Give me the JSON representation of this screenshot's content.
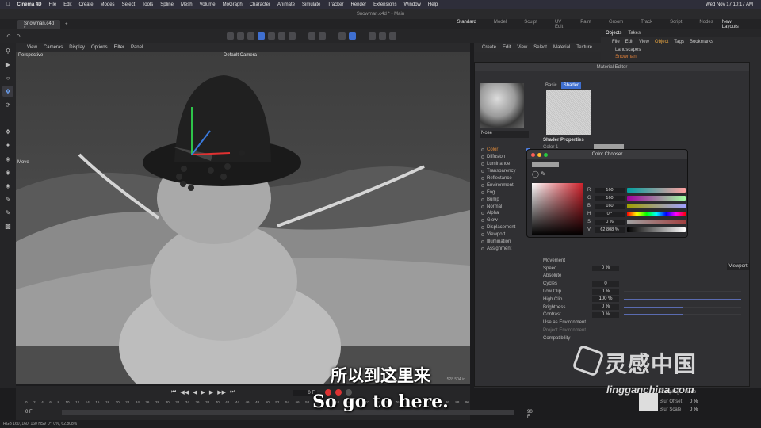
{
  "menubar": {
    "app": "Cinema 4D",
    "items": [
      "File",
      "Edit",
      "Create",
      "Modes",
      "Select",
      "Tools",
      "Spline",
      "Mesh",
      "Volume",
      "MoGraph",
      "Character",
      "Animate",
      "Simulate",
      "Tracker",
      "Render",
      "Extensions",
      "Window",
      "Help"
    ],
    "clock": "Wed Nov 17  10:17 AM"
  },
  "window": {
    "title": "Snowman.c4d * - Main"
  },
  "tabs": {
    "document": "Snowman.c4d *",
    "layouts": [
      "Standard",
      "Model",
      "Sculpt",
      "UV Edit",
      "Paint",
      "Groom",
      "Track",
      "Script",
      "Nodes"
    ],
    "new_layouts": "New Layouts"
  },
  "viewport": {
    "menu": [
      "View",
      "Cameras",
      "Display",
      "Options",
      "Filter",
      "Panel"
    ],
    "label": "Perspective",
    "camera": "Default Camera",
    "tool_hint": "Move",
    "scale": "528.504 in"
  },
  "objects": {
    "tabs": [
      "Objects",
      "Takes"
    ],
    "menu": [
      "File",
      "Edit",
      "View",
      "Object",
      "Tags",
      "Bookmarks"
    ],
    "rows": [
      "Landscapes",
      "Snowman"
    ]
  },
  "material_manager": {
    "menu": [
      "Create",
      "Edit",
      "View",
      "Select",
      "Material",
      "Texture"
    ]
  },
  "material_editor": {
    "title": "Material Editor",
    "name": "Nose",
    "tabs": [
      "Basic",
      "Shader"
    ],
    "shader_heading": "Shader Properties",
    "color_label": "Color 1",
    "channels": [
      {
        "label": "Color",
        "checked": true,
        "active": true
      },
      {
        "label": "Diffusion",
        "checked": false
      },
      {
        "label": "Luminance",
        "checked": false
      },
      {
        "label": "Transparency",
        "checked": false
      },
      {
        "label": "Reflectance",
        "checked": true
      },
      {
        "label": "Environment",
        "checked": false
      },
      {
        "label": "Fog",
        "checked": false
      },
      {
        "label": "Bump",
        "checked": true
      },
      {
        "label": "Normal",
        "checked": false
      },
      {
        "label": "Alpha",
        "checked": false
      },
      {
        "label": "Glow",
        "checked": false
      },
      {
        "label": "Displacement",
        "checked": false
      },
      {
        "label": "Viewport"
      },
      {
        "label": "Illumination"
      },
      {
        "label": "Assignment"
      }
    ],
    "props": [
      {
        "label": "Movement",
        "value": ""
      },
      {
        "label": "Speed",
        "value": "0 %"
      },
      {
        "label": "Absolute",
        "value": ""
      },
      {
        "label": "Cycles",
        "value": "0"
      },
      {
        "label": "Low Clip",
        "value": "0 %",
        "fill": 0.0
      },
      {
        "label": "High Clip",
        "value": "100 %",
        "fill": 1.0
      },
      {
        "label": "Brightness",
        "value": "0 %",
        "fill": 0.5
      },
      {
        "label": "Contrast",
        "value": "0 %",
        "fill": 0.5
      },
      {
        "label": "Use as Environment",
        "value": ""
      },
      {
        "label": "Project Environment",
        "value": "",
        "dim": true
      },
      {
        "label": "Compatibility",
        "value": ""
      }
    ],
    "viewport_btn": "Viewport"
  },
  "color_chooser": {
    "title": "Color Chooser",
    "rows": [
      {
        "label": "R",
        "value": "160"
      },
      {
        "label": "G",
        "value": "160"
      },
      {
        "label": "B",
        "value": "160"
      },
      {
        "label": "H",
        "value": "0 °"
      },
      {
        "label": "S",
        "value": "0 %"
      },
      {
        "label": "V",
        "value": "62.808 %"
      }
    ]
  },
  "timeline": {
    "frame": "0 F",
    "start": "0 F",
    "end": "90 F",
    "end2": "90 F",
    "ticks": [
      "0",
      "2",
      "4",
      "6",
      "8",
      "10",
      "12",
      "14",
      "16",
      "18",
      "20",
      "22",
      "24",
      "26",
      "28",
      "30",
      "32",
      "34",
      "36",
      "38",
      "40",
      "42",
      "44",
      "46",
      "48",
      "50",
      "52",
      "54",
      "56",
      "58",
      "60",
      "62",
      "64",
      "66",
      "68",
      "70",
      "72",
      "74",
      "76",
      "78",
      "80",
      "82",
      "84",
      "86",
      "88",
      "90"
    ]
  },
  "status": {
    "text": "RGB 160, 160, 160  HSV 0°, 0%, 62.808%"
  },
  "right_bottom": {
    "sampling": "Sampling",
    "none": "None",
    "blur_offset": "Blur Offset",
    "blur_scale": "Blur Scale",
    "val": "0 %"
  },
  "subtitles": {
    "cn": "所以到这里来",
    "en": "So go to here."
  },
  "watermark": {
    "cn": "灵感中国",
    "url": "lingganchina.com"
  }
}
